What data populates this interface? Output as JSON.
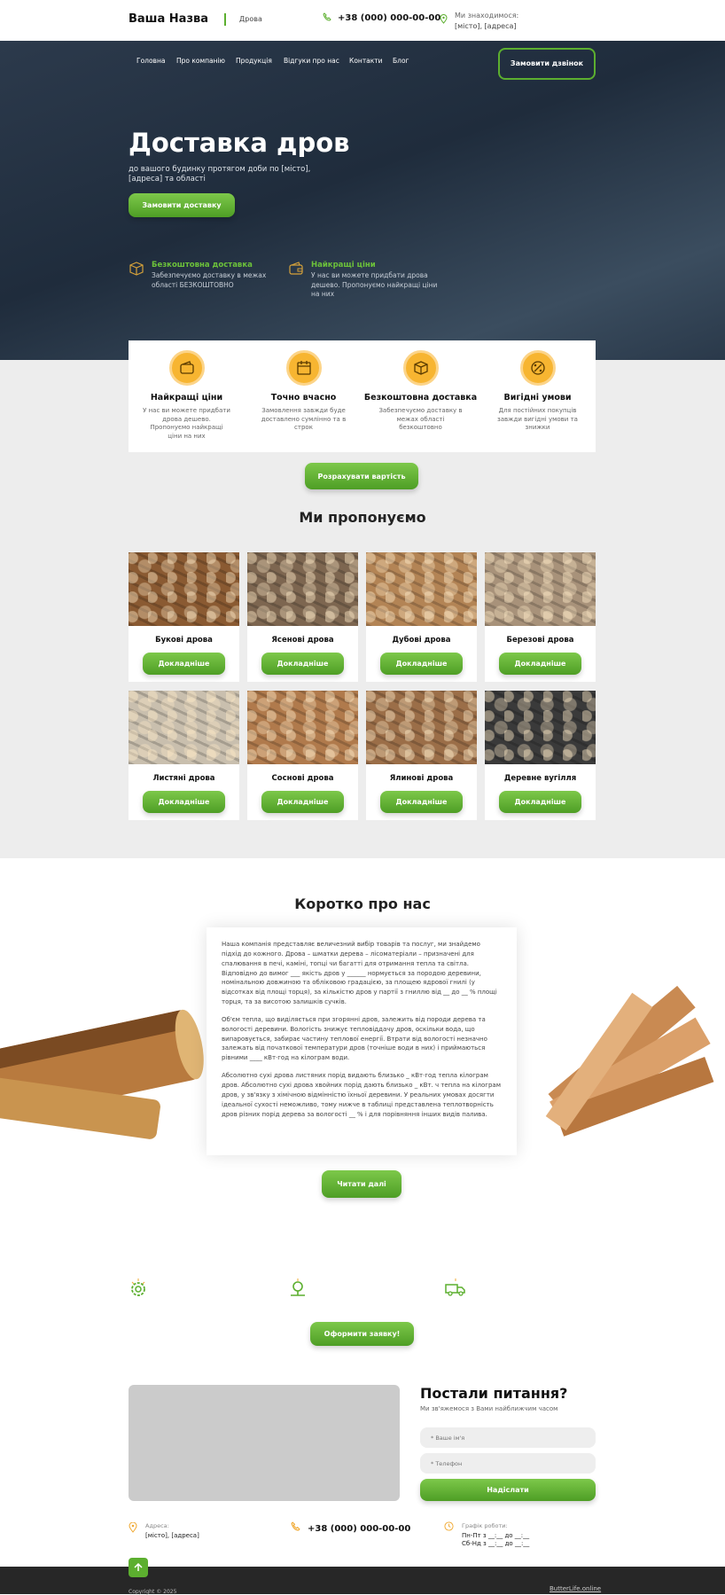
{
  "header": {
    "logo": "Ваша Назва",
    "subtitle": "Дрова",
    "phone": "+38 (000) 000-00-00",
    "location_label": "Ми знаходимося:",
    "location_value": "[місто], [адреса]"
  },
  "nav": [
    "Головна",
    "Про компанію",
    "Продукція",
    "Відгуки про нас",
    "Контакти",
    "Блог"
  ],
  "call_button": "Замовити дзвінок",
  "hero": {
    "title": "Доставка дров",
    "subtitle": "до вашого будинку протягом доби по [місто], [адреса] та області",
    "button": "Замовити доставку",
    "features": [
      {
        "icon": "box-icon",
        "title": "Безкоштовна доставка",
        "desc": "Забезпечуємо доставку в межах області БЕЗКОШТОВНО"
      },
      {
        "icon": "wallet-icon",
        "title": "Найкращі ціни",
        "desc": "У нас ви можете придбати дрова дешево. Пропонуємо найкращі ціни на них"
      }
    ]
  },
  "features": [
    {
      "icon": "wallet-icon",
      "title": "Найкращі ціни",
      "desc": "У нас ви можете придбати дрова дешево. Пропонуємо найкращі ціни на них"
    },
    {
      "icon": "calendar-icon",
      "title": "Точно вчасно",
      "desc": "Замовлення завжди буде доставлено сумлінно та в строк"
    },
    {
      "icon": "box-icon",
      "title": "Безкоштовна доставка",
      "desc": "Забезпечуємо доставку в межах області безкоштовно"
    },
    {
      "icon": "percent-icon",
      "title": "Вигідні умови",
      "desc": "Для постійних покупців завжди вигідні умови та знижки"
    }
  ],
  "calc_button": "Розрахувати вартість",
  "offer_title": "Ми пропонуємо",
  "more_label": "Докладніше",
  "products": [
    {
      "name": "Букові дрова",
      "tone": "#8a5a32"
    },
    {
      "name": "Ясенові дрова",
      "tone": "#7d6650"
    },
    {
      "name": "Дубові дрова",
      "tone": "#b38455"
    },
    {
      "name": "Березові дрова",
      "tone": "#a8927a"
    },
    {
      "name": "Листяні дрова",
      "tone": "#c9bfae"
    },
    {
      "name": "Соснові дрова",
      "tone": "#b07a4c"
    },
    {
      "name": "Ялинові дрова",
      "tone": "#9b6e48"
    },
    {
      "name": "Деревне вугілля",
      "tone": "#3a3a3a"
    }
  ],
  "about": {
    "title": "Коротко про нас",
    "p1": "Наша компанія представляє величезний вибір товарів та послуг, ми знайдемо підхід до кожного. Дрова – шматки дерева – лісоматеріали – призначені для спалювання в печі, каміні, топці чи багатті для отримання тепла та світла. Відповідно до вимог ___ якість дров у ______ нормується за породою деревини, номінальною довжиною та обліковою градацією, за площею ядрової гнилі (у відсотках від площі торця), за кількістю дров у партії з гниллю від __ до __ % площі торця, та за висотою залишків сучків.",
    "p2": "Об'єм тепла, що виділяється при згорянні дров, залежить від породи дерева та вологості деревини. Вологість знижує тепловіддачу дров, оскільки вода, що випаровується, забирає частину теплової енергії. Втрати від вологості незначно залежать від початкової температури дров (точніше води в них) і приймаються рівними ____ кВт·год на кілограм води.",
    "p3": "Абсолютно сухі дрова листяних порід видають близько _ кВт·год тепла кілограм дров. Абсолютно сухі дрова хвойних порід дають близько _ кВт. ч тепла на кілограм дров, у зв'язку з хімічною відмінністю їхньої деревини. У реальних умовах досягти ідеальної сухості неможливо, тому нижче в таблиці представлена теплотворність дров різних порід дерева за вологості __ % і для порівняння інших видів палива.",
    "button": "Читати далі"
  },
  "order_button": "Оформити заявку!",
  "contact": {
    "title": "Постали питання?",
    "subtitle": "Ми зв'яжемося з Вами найближчим часом",
    "name_placeholder": "* Ваше ім'я",
    "phone_placeholder": "* Телефон",
    "send": "Надіслати",
    "address_label": "Адреса:",
    "address_value": "[місто], [адреса]",
    "phone": "+38 (000) 000-00-00",
    "schedule_label": "Графік роботи:",
    "schedule_1": "Пн-Пт з __:__ до __:__",
    "schedule_2": "Сб-Нд з __:__ до __:__"
  },
  "footer": {
    "copyright": "Copyright © 2025",
    "link": "ButterLife.online"
  },
  "colors": {
    "accent": "#5caf2f",
    "orange": "#f7b531",
    "hero_bg": "#243244"
  }
}
